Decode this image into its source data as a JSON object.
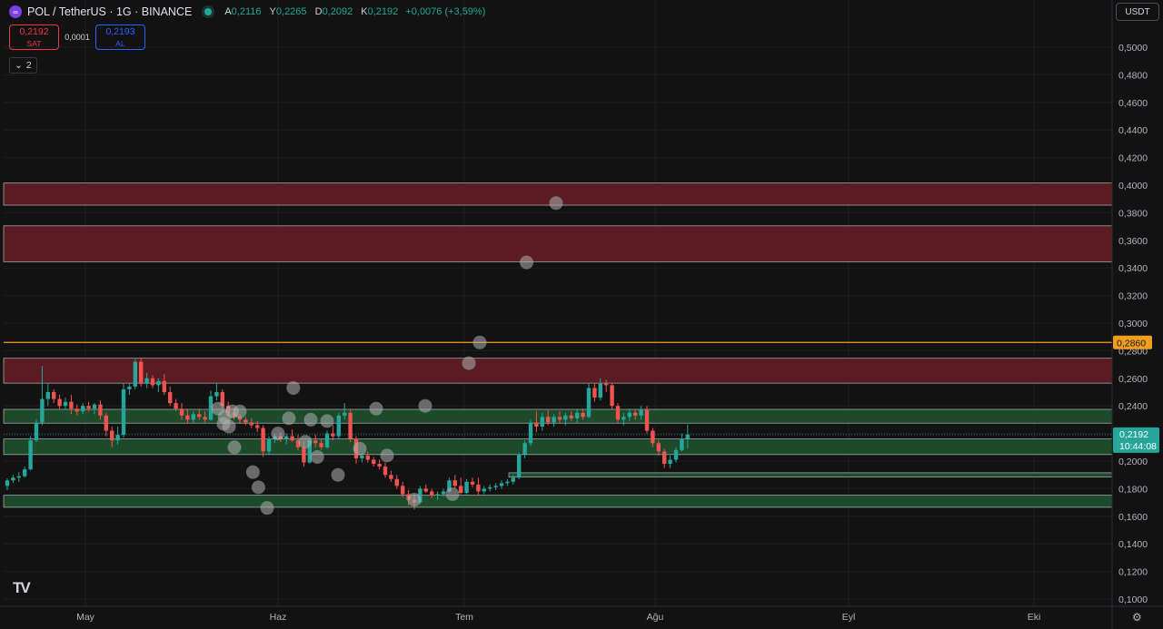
{
  "header": {
    "symbol_title": "POL / TetherUS · 1G · BINANCE",
    "logo_glyph": "∞",
    "ohlc": [
      {
        "key": "A",
        "value": "0,2116"
      },
      {
        "key": "Y",
        "value": "0,2265"
      },
      {
        "key": "D",
        "value": "0,2092"
      },
      {
        "key": "K",
        "value": "0,2192"
      }
    ],
    "change": "+0,0076 (+3,59%)"
  },
  "trade": {
    "sell_price": "0,2192",
    "sell_label": "SAT",
    "spread": "0,0001",
    "buy_price": "0,2193",
    "buy_label": "AL"
  },
  "indicators_count": "2",
  "currency_button": "USDT",
  "colors": {
    "up": "#26a69a",
    "down": "#ef5350",
    "resistance_zone": "#5a1c22",
    "support_zone": "#1c4a2a",
    "orange_line": "#f29d1e",
    "ghost_marker": "#b0b0b0"
  },
  "chart_data": {
    "type": "candlestick",
    "yaxis_ticks": [
      "0,1000",
      "0,1200",
      "0,1400",
      "0,1600",
      "0,1800",
      "0,2000",
      "0,2200",
      "0,2400",
      "0,2600",
      "0,2800",
      "0,3000",
      "0,3200",
      "0,3400",
      "0,3600",
      "0,3800",
      "0,4000",
      "0,4200",
      "0,4400",
      "0,4600",
      "0,4800",
      "0,5000"
    ],
    "ylim": [
      0.1,
      0.5
    ],
    "xaxis_ticks": [
      "May",
      "Haz",
      "Tem",
      "Ağu",
      "Eyl",
      "Eki"
    ],
    "current_price_label": "0,2192",
    "countdown_label": "10:44:08",
    "orange_line_label": "0,2860",
    "orange_line_value": 0.286,
    "resistance_zones": [
      [
        0.3855,
        0.4015
      ],
      [
        0.3445,
        0.3705
      ],
      [
        0.2565,
        0.2745
      ]
    ],
    "support_zones": [
      [
        0.2275,
        0.2375
      ],
      [
        0.2047,
        0.216
      ],
      [
        0.1885,
        0.1915
      ],
      [
        0.1665,
        0.1752
      ]
    ],
    "candles": [
      [
        0.182,
        0.1875,
        0.179,
        0.186
      ],
      [
        0.186,
        0.19,
        0.184,
        0.188
      ],
      [
        0.188,
        0.192,
        0.185,
        0.189
      ],
      [
        0.189,
        0.196,
        0.188,
        0.194
      ],
      [
        0.194,
        0.218,
        0.193,
        0.215
      ],
      [
        0.215,
        0.23,
        0.214,
        0.228
      ],
      [
        0.228,
        0.269,
        0.226,
        0.245
      ],
      [
        0.245,
        0.256,
        0.24,
        0.25
      ],
      [
        0.25,
        0.252,
        0.242,
        0.245
      ],
      [
        0.245,
        0.248,
        0.238,
        0.24
      ],
      [
        0.24,
        0.246,
        0.237,
        0.243
      ],
      [
        0.243,
        0.248,
        0.234,
        0.238
      ],
      [
        0.238,
        0.241,
        0.233,
        0.236
      ],
      [
        0.236,
        0.242,
        0.234,
        0.24
      ],
      [
        0.24,
        0.243,
        0.236,
        0.238
      ],
      [
        0.238,
        0.242,
        0.234,
        0.241
      ],
      [
        0.241,
        0.244,
        0.23,
        0.233
      ],
      [
        0.233,
        0.235,
        0.218,
        0.222
      ],
      [
        0.222,
        0.225,
        0.21,
        0.215
      ],
      [
        0.215,
        0.225,
        0.212,
        0.219
      ],
      [
        0.219,
        0.256,
        0.217,
        0.252
      ],
      [
        0.252,
        0.256,
        0.248,
        0.254
      ],
      [
        0.254,
        0.274,
        0.252,
        0.272
      ],
      [
        0.272,
        0.275,
        0.254,
        0.256
      ],
      [
        0.256,
        0.264,
        0.253,
        0.26
      ],
      [
        0.26,
        0.262,
        0.253,
        0.255
      ],
      [
        0.255,
        0.26,
        0.25,
        0.258
      ],
      [
        0.258,
        0.263,
        0.248,
        0.25
      ],
      [
        0.25,
        0.254,
        0.24,
        0.242
      ],
      [
        0.242,
        0.245,
        0.236,
        0.238
      ],
      [
        0.238,
        0.242,
        0.23,
        0.233
      ],
      [
        0.233,
        0.238,
        0.227,
        0.23
      ],
      [
        0.23,
        0.236,
        0.228,
        0.234
      ],
      [
        0.234,
        0.238,
        0.23,
        0.232
      ],
      [
        0.232,
        0.236,
        0.228,
        0.23
      ],
      [
        0.23,
        0.251,
        0.229,
        0.247
      ],
      [
        0.247,
        0.256,
        0.244,
        0.25
      ],
      [
        0.25,
        0.252,
        0.238,
        0.24
      ],
      [
        0.24,
        0.243,
        0.233,
        0.235
      ],
      [
        0.235,
        0.238,
        0.23,
        0.232
      ],
      [
        0.232,
        0.234,
        0.227,
        0.23
      ],
      [
        0.23,
        0.232,
        0.226,
        0.228
      ],
      [
        0.228,
        0.231,
        0.224,
        0.226
      ],
      [
        0.226,
        0.229,
        0.221,
        0.224
      ],
      [
        0.224,
        0.226,
        0.203,
        0.207
      ],
      [
        0.207,
        0.218,
        0.205,
        0.216
      ],
      [
        0.216,
        0.22,
        0.213,
        0.218
      ],
      [
        0.218,
        0.221,
        0.214,
        0.216
      ],
      [
        0.216,
        0.22,
        0.212,
        0.218
      ],
      [
        0.218,
        0.223,
        0.214,
        0.215
      ],
      [
        0.215,
        0.219,
        0.208,
        0.21
      ],
      [
        0.21,
        0.214,
        0.196,
        0.199
      ],
      [
        0.199,
        0.217,
        0.198,
        0.215
      ],
      [
        0.215,
        0.219,
        0.21,
        0.213
      ],
      [
        0.213,
        0.216,
        0.208,
        0.21
      ],
      [
        0.21,
        0.222,
        0.209,
        0.22
      ],
      [
        0.22,
        0.226,
        0.215,
        0.218
      ],
      [
        0.218,
        0.235,
        0.216,
        0.233
      ],
      [
        0.233,
        0.242,
        0.23,
        0.235
      ],
      [
        0.235,
        0.237,
        0.214,
        0.216
      ],
      [
        0.216,
        0.218,
        0.198,
        0.202
      ],
      [
        0.202,
        0.206,
        0.199,
        0.204
      ],
      [
        0.204,
        0.207,
        0.199,
        0.201
      ],
      [
        0.201,
        0.203,
        0.196,
        0.198
      ],
      [
        0.198,
        0.201,
        0.194,
        0.196
      ],
      [
        0.196,
        0.199,
        0.188,
        0.19
      ],
      [
        0.19,
        0.193,
        0.185,
        0.187
      ],
      [
        0.187,
        0.19,
        0.18,
        0.182
      ],
      [
        0.182,
        0.185,
        0.174,
        0.176
      ],
      [
        0.176,
        0.179,
        0.168,
        0.172
      ],
      [
        0.172,
        0.176,
        0.165,
        0.17
      ],
      [
        0.17,
        0.182,
        0.169,
        0.18
      ],
      [
        0.18,
        0.183,
        0.177,
        0.178
      ],
      [
        0.178,
        0.18,
        0.173,
        0.175
      ],
      [
        0.175,
        0.178,
        0.172,
        0.176
      ],
      [
        0.176,
        0.18,
        0.174,
        0.178
      ],
      [
        0.178,
        0.188,
        0.177,
        0.186
      ],
      [
        0.186,
        0.19,
        0.18,
        0.182
      ],
      [
        0.182,
        0.188,
        0.176,
        0.177
      ],
      [
        0.177,
        0.187,
        0.176,
        0.185
      ],
      [
        0.185,
        0.188,
        0.181,
        0.183
      ],
      [
        0.183,
        0.188,
        0.175,
        0.178
      ],
      [
        0.178,
        0.182,
        0.176,
        0.18
      ],
      [
        0.18,
        0.183,
        0.178,
        0.181
      ],
      [
        0.181,
        0.184,
        0.179,
        0.182
      ],
      [
        0.182,
        0.186,
        0.18,
        0.184
      ],
      [
        0.184,
        0.187,
        0.182,
        0.185
      ],
      [
        0.185,
        0.19,
        0.183,
        0.188
      ],
      [
        0.188,
        0.206,
        0.187,
        0.205
      ],
      [
        0.205,
        0.215,
        0.202,
        0.213
      ],
      [
        0.213,
        0.23,
        0.211,
        0.228
      ],
      [
        0.228,
        0.236,
        0.221,
        0.225
      ],
      [
        0.225,
        0.235,
        0.222,
        0.232
      ],
      [
        0.232,
        0.237,
        0.226,
        0.228
      ],
      [
        0.228,
        0.234,
        0.225,
        0.232
      ],
      [
        0.232,
        0.236,
        0.228,
        0.23
      ],
      [
        0.23,
        0.235,
        0.226,
        0.233
      ],
      [
        0.233,
        0.236,
        0.229,
        0.231
      ],
      [
        0.231,
        0.238,
        0.228,
        0.235
      ],
      [
        0.235,
        0.238,
        0.23,
        0.232
      ],
      [
        0.232,
        0.256,
        0.231,
        0.253
      ],
      [
        0.253,
        0.256,
        0.243,
        0.246
      ],
      [
        0.246,
        0.26,
        0.244,
        0.256
      ],
      [
        0.256,
        0.259,
        0.25,
        0.255
      ],
      [
        0.255,
        0.256,
        0.238,
        0.24
      ],
      [
        0.24,
        0.242,
        0.228,
        0.23
      ],
      [
        0.23,
        0.235,
        0.226,
        0.232
      ],
      [
        0.232,
        0.238,
        0.229,
        0.235
      ],
      [
        0.235,
        0.237,
        0.23,
        0.233
      ],
      [
        0.233,
        0.24,
        0.23,
        0.237
      ],
      [
        0.237,
        0.24,
        0.22,
        0.222
      ],
      [
        0.222,
        0.224,
        0.21,
        0.213
      ],
      [
        0.213,
        0.215,
        0.204,
        0.207
      ],
      [
        0.207,
        0.209,
        0.195,
        0.198
      ],
      [
        0.198,
        0.204,
        0.195,
        0.201
      ],
      [
        0.201,
        0.21,
        0.199,
        0.208
      ],
      [
        0.208,
        0.22,
        0.207,
        0.216
      ],
      [
        0.216,
        0.2265,
        0.2092,
        0.2192
      ]
    ],
    "ghost_markers": [
      [
        0.235,
        0.225
      ],
      [
        0.245,
        0.236
      ],
      [
        0.225,
        0.238
      ],
      [
        0.23,
        0.227
      ],
      [
        0.231,
        0.232
      ],
      [
        0.238,
        0.236
      ],
      [
        0.24,
        0.21
      ],
      [
        0.257,
        0.192
      ],
      [
        0.262,
        0.181
      ],
      [
        0.27,
        0.166
      ],
      [
        0.28,
        0.22
      ],
      [
        0.29,
        0.231
      ],
      [
        0.294,
        0.253
      ],
      [
        0.305,
        0.214
      ],
      [
        0.31,
        0.23
      ],
      [
        0.316,
        0.203
      ],
      [
        0.325,
        0.229
      ],
      [
        0.335,
        0.19
      ],
      [
        0.355,
        0.209
      ],
      [
        0.38,
        0.204
      ],
      [
        0.405,
        0.172
      ],
      [
        0.44,
        0.176
      ],
      [
        0.455,
        0.271
      ],
      [
        0.465,
        0.286
      ],
      [
        0.508,
        0.344
      ],
      [
        0.535,
        0.387
      ],
      [
        0.37,
        0.238
      ],
      [
        0.415,
        0.24
      ]
    ]
  }
}
